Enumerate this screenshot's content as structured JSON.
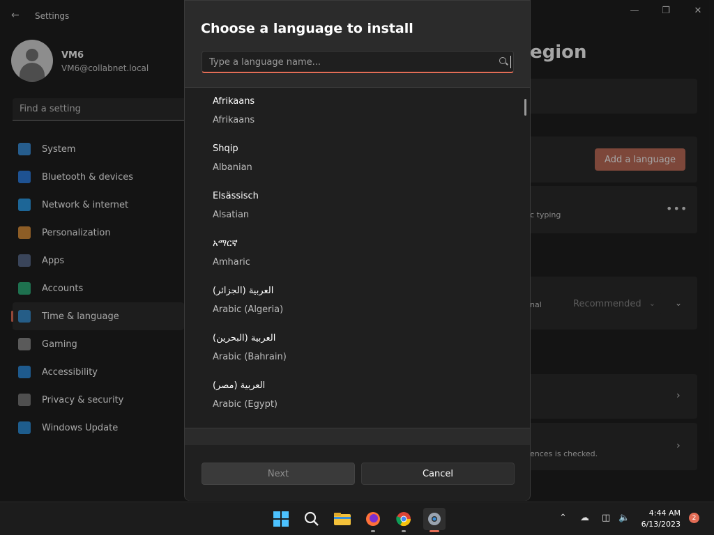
{
  "app": {
    "title": "Settings"
  },
  "user": {
    "name": "VM6",
    "email": "VM6@collabnet.local"
  },
  "sidebar": {
    "search_placeholder": "Find a setting",
    "items": [
      {
        "label": "System",
        "color": "#3b8fd9"
      },
      {
        "label": "Bluetooth & devices",
        "color": "#2f7fe0"
      },
      {
        "label": "Network & internet",
        "color": "#2d9de8"
      },
      {
        "label": "Personalization",
        "color": "#d9903b"
      },
      {
        "label": "Apps",
        "color": "#5a6a8a"
      },
      {
        "label": "Accounts",
        "color": "#2fae7a"
      },
      {
        "label": "Time & language",
        "color": "#3a8fd0"
      },
      {
        "label": "Gaming",
        "color": "#8a8a8a"
      },
      {
        "label": "Accessibility",
        "color": "#2f8ad9"
      },
      {
        "label": "Privacy & security",
        "color": "#7a7a7a"
      },
      {
        "label": "Windows Update",
        "color": "#2f8fd9"
      }
    ],
    "active_index": 6
  },
  "background": {
    "title_fragment": "egion",
    "add_language_label": "Add a language",
    "typing_fragment": "c typing",
    "optional_fragment": "nal",
    "recommended_label": "Recommended",
    "checked_fragment": "ences is checked."
  },
  "dialog": {
    "title": "Choose a language to install",
    "search_placeholder": "Type a language name...",
    "languages": [
      {
        "native": "Afrikaans",
        "english": "Afrikaans"
      },
      {
        "native": "Shqip",
        "english": "Albanian"
      },
      {
        "native": "Elsässisch",
        "english": "Alsatian"
      },
      {
        "native": "አማርኛ",
        "english": "Amharic"
      },
      {
        "native": "العربية (الجزائر)",
        "english": "Arabic (Algeria)"
      },
      {
        "native": "العربية (البحرين)",
        "english": "Arabic (Bahrain)"
      },
      {
        "native": "العربية (مصر)",
        "english": "Arabic (Egypt)"
      }
    ],
    "next_label": "Next",
    "cancel_label": "Cancel"
  },
  "taskbar": {
    "time": "4:44 AM",
    "date": "6/13/2023",
    "notification_count": "2"
  }
}
